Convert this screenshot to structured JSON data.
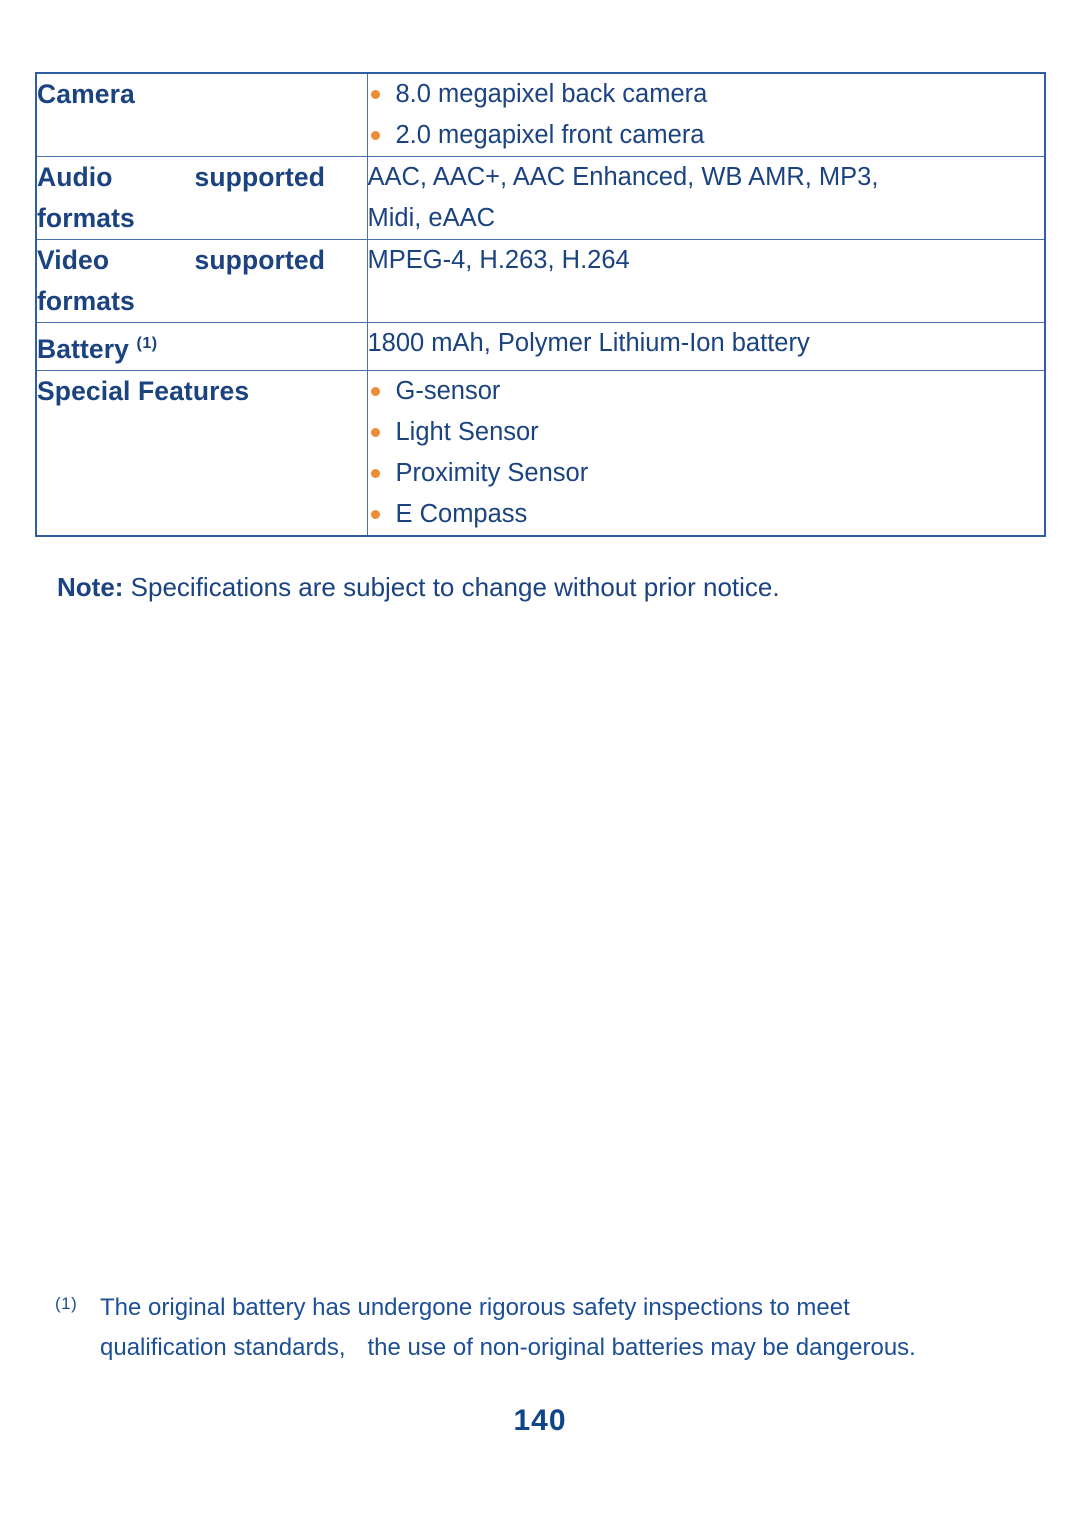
{
  "document": {
    "page_number": "140",
    "colors": {
      "text_navy": "#1b4380",
      "bullet_orange": "#ef8c36",
      "table_border": "#4a72b0",
      "table_outer_border": "#2f5da0"
    }
  },
  "spec_table": {
    "rows": [
      {
        "label": "Camera",
        "label_style": "plain",
        "superscript": "",
        "value_type": "bullets",
        "bullets": [
          "8.0 megapixel back camera",
          "2.0 megapixel front camera"
        ]
      },
      {
        "label_line1": "Audio",
        "label_line2": "supported",
        "label_line3": "formats",
        "label_style": "justified-two-line",
        "superscript": "",
        "value_type": "lines",
        "lines": [
          "AAC, AAC+, AAC Enhanced, WB AMR, MP3,",
          "Midi, eAAC"
        ]
      },
      {
        "label_line1": "Video",
        "label_line2": "supported",
        "label_line3": "formats",
        "label_style": "justified-two-line",
        "superscript": "",
        "value_type": "lines",
        "lines": [
          "MPEG-4, H.263, H.264"
        ]
      },
      {
        "label": "Battery",
        "label_style": "plain",
        "superscript": "(1)",
        "value_type": "lines",
        "lines": [
          "1800 mAh, Polymer Lithium-Ion battery"
        ]
      },
      {
        "label": "Special Features",
        "label_style": "plain",
        "superscript": "",
        "value_type": "bullets",
        "bullets": [
          "G-sensor",
          "Light Sensor",
          "Proximity Sensor",
          "E Compass"
        ]
      }
    ]
  },
  "note": {
    "label": "Note:",
    "text": " Specifications are subject to change without prior notice."
  },
  "footnote": {
    "marker": "(1)",
    "line1": "The original battery has undergone rigorous safety inspections to meet",
    "line2_part1": "qualification standards,",
    "line2_part2": "the use of non-original batteries may be dangerous."
  }
}
